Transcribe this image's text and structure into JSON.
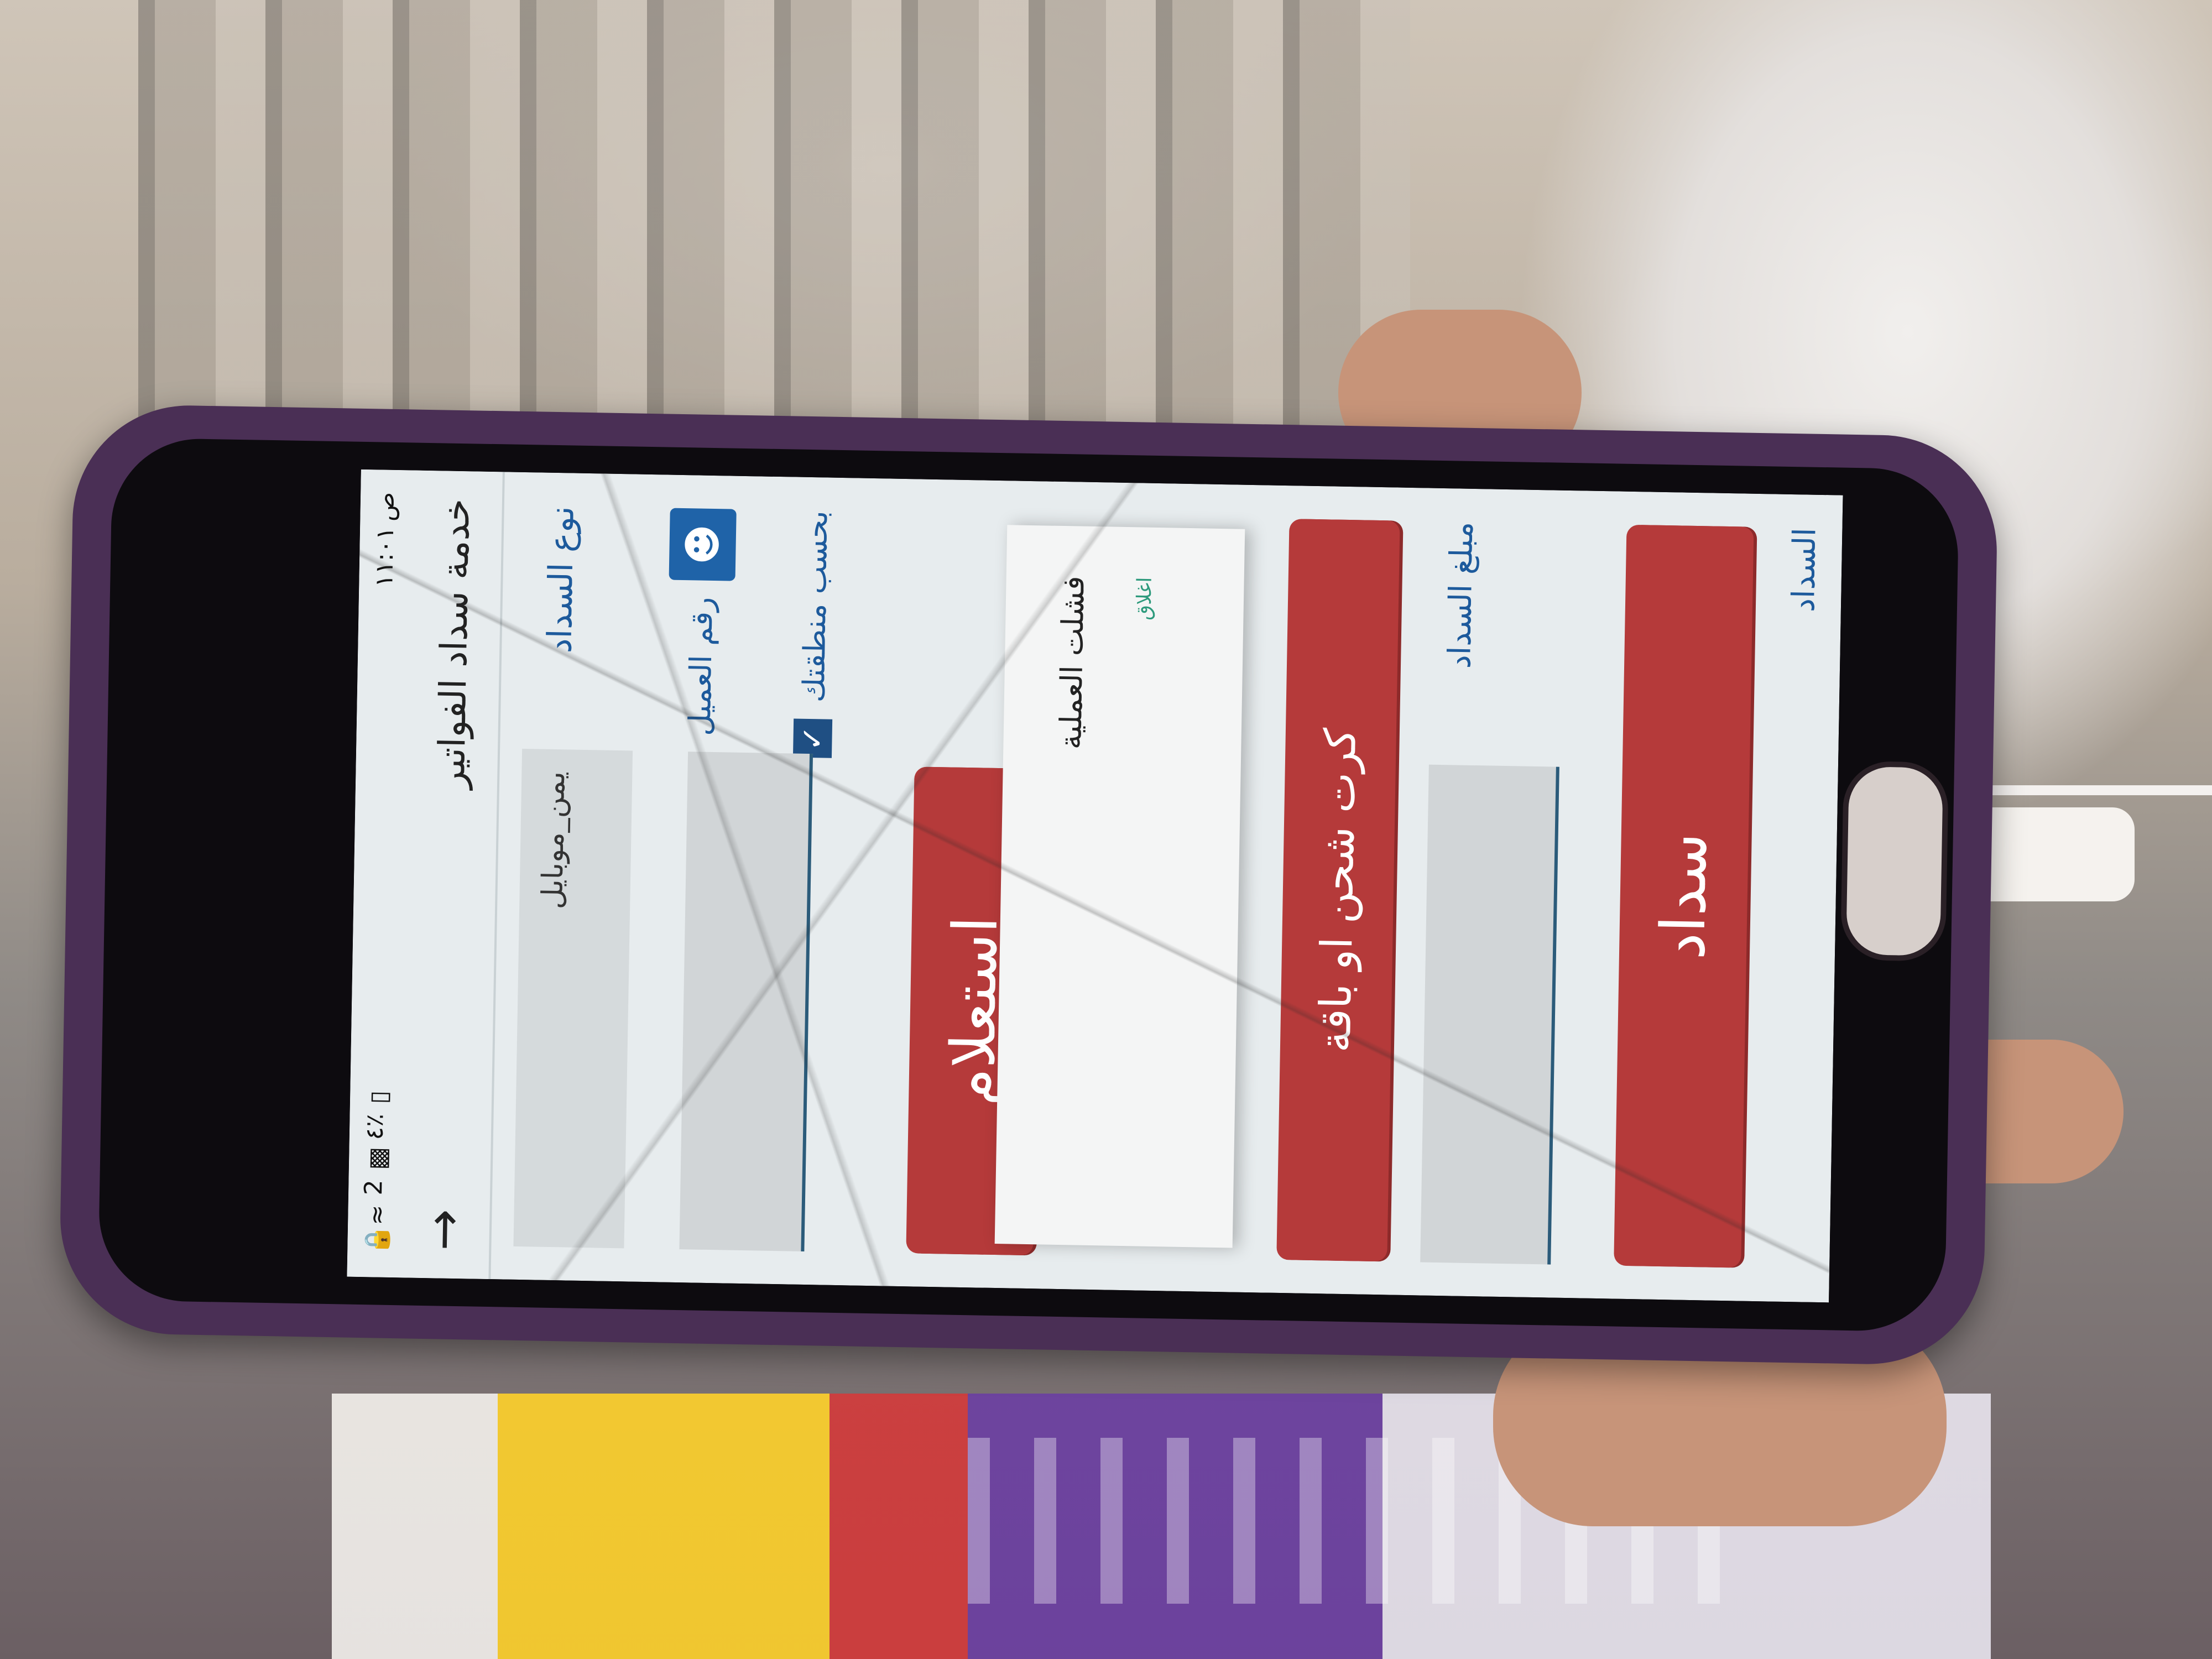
{
  "status_bar": {
    "time": "١١:٠١",
    "period": "ص",
    "battery": "٤٪",
    "sim_badge": "2"
  },
  "app_bar": {
    "title": "خدمة سداد الفواتير"
  },
  "form": {
    "payment_type_label": "نوع السداد",
    "payment_type_value": "يمن_موبايل",
    "option_number": "رقم العميل",
    "option_region": "بحسب منطقتك",
    "inquiry_button": "استعلام",
    "recharge_button": "كرت شحن او باقة",
    "amount_label": "مبلغ السداد",
    "pay_button": "سداد",
    "footer_partial": "السداد"
  },
  "dialog": {
    "message": "فشلت العملية",
    "close_label": "اغلاق"
  },
  "icons": {
    "back": "arrow-back-icon",
    "customer": "person-card-icon",
    "checked": "checkbox-checked-icon"
  },
  "colors": {
    "primary_red": "#b53a3a",
    "link_blue": "#1d5a9c",
    "dialog_accent": "#2d9a7c"
  }
}
